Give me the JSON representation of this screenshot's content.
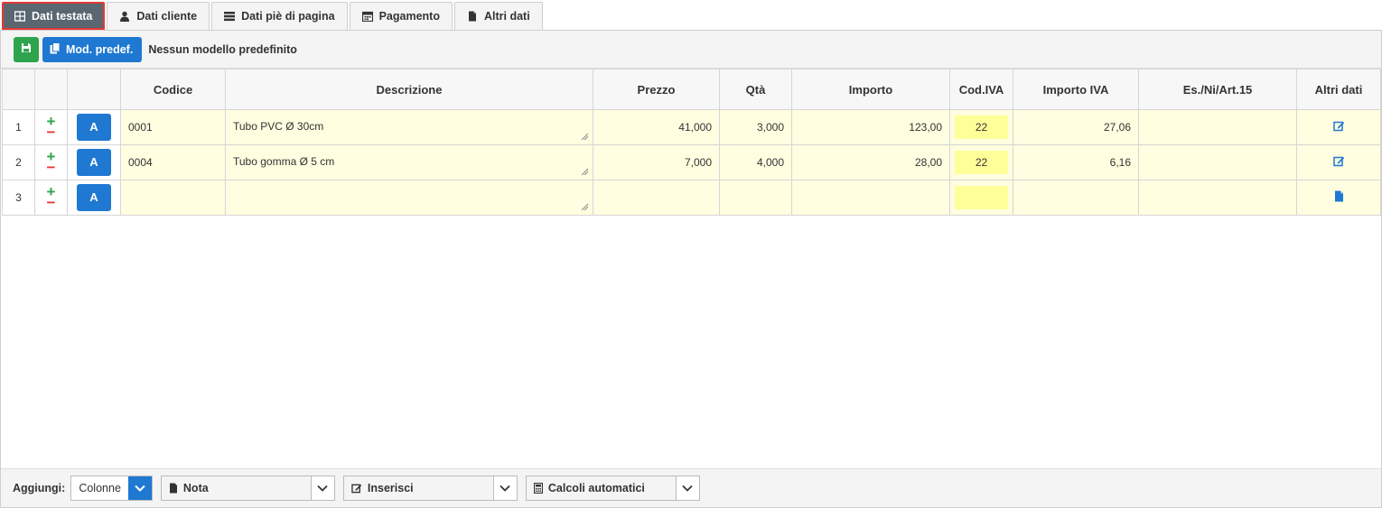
{
  "tabs": [
    {
      "label": "Dati testata",
      "icon": "table-icon",
      "active": true
    },
    {
      "label": "Dati cliente",
      "icon": "user-icon",
      "active": false
    },
    {
      "label": "Dati piè di pagina",
      "icon": "list-icon",
      "active": false
    },
    {
      "label": "Pagamento",
      "icon": "calendar-icon",
      "active": false
    },
    {
      "label": "Altri dati",
      "icon": "file-icon",
      "active": false
    }
  ],
  "toolbar": {
    "save_icon": "save-icon",
    "mod_label": "Mod. predef.",
    "model_text": "Nessun modello predefinito"
  },
  "table": {
    "headers": [
      "",
      "",
      "",
      "Codice",
      "Descrizione",
      "Prezzo",
      "Qtà",
      "Importo",
      "Cod.IVA",
      "Importo IVA",
      "Es./Ni/Art.15",
      "Altri dati"
    ],
    "rows": [
      {
        "n": "1",
        "a": "A",
        "codice": "0001",
        "descrizione": "Tubo PVC Ø 30cm",
        "prezzo": "41,000",
        "qta": "3,000",
        "importo": "123,00",
        "cod_iva": "22",
        "importo_iva": "27,06",
        "es": "",
        "altri_icon": "edit-icon"
      },
      {
        "n": "2",
        "a": "A",
        "codice": "0004",
        "descrizione": "Tubo gomma Ø 5 cm",
        "prezzo": "7,000",
        "qta": "4,000",
        "importo": "28,00",
        "cod_iva": "22",
        "importo_iva": "6,16",
        "es": "",
        "altri_icon": "edit-icon"
      },
      {
        "n": "3",
        "a": "A",
        "codice": "",
        "descrizione": "",
        "prezzo": "",
        "qta": "",
        "importo": "",
        "cod_iva": "",
        "importo_iva": "",
        "es": "",
        "altri_icon": "file-icon"
      }
    ]
  },
  "footer": {
    "aggiungi_label": "Aggiungi:",
    "colonne": "Colonne",
    "nota": "Nota",
    "inserisci": "Inserisci",
    "calcoli": "Calcoli automatici"
  },
  "colors": {
    "primary": "#1f78d1",
    "success": "#2ea44f",
    "danger": "#e53935",
    "row_bg": "#fffee0",
    "iva_bg": "#ffff99",
    "active_tab": "#5a6670"
  }
}
